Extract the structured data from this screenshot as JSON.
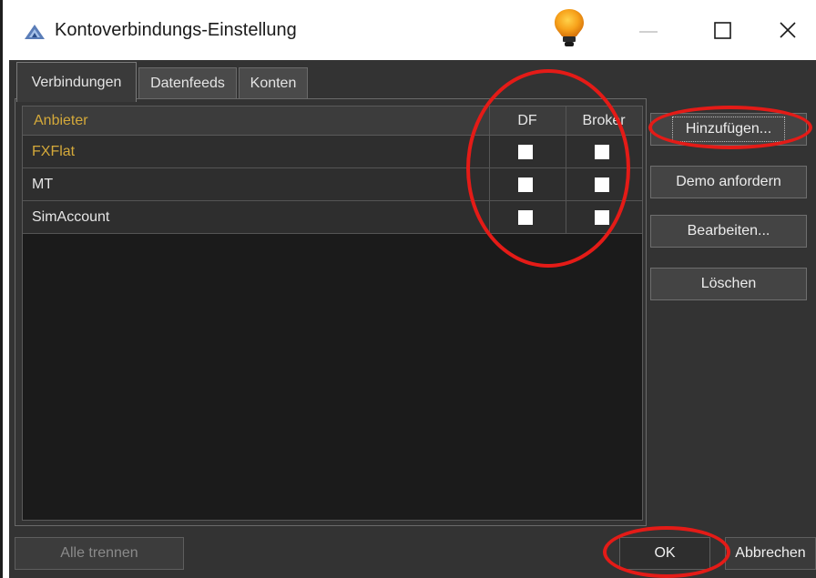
{
  "window": {
    "title": "Kontoverbindungs-Einstellung"
  },
  "tabs": [
    {
      "label": "Verbindungen",
      "active": true
    },
    {
      "label": "Datenfeeds",
      "active": false
    },
    {
      "label": "Konten",
      "active": false
    }
  ],
  "grid": {
    "columns": [
      "Anbieter",
      "DF",
      "Broker"
    ],
    "rows": [
      {
        "anbieter": "FXFlat",
        "df": false,
        "broker": false,
        "highlight": true
      },
      {
        "anbieter": "MT",
        "df": false,
        "broker": false,
        "highlight": false
      },
      {
        "anbieter": "SimAccount",
        "df": false,
        "broker": false,
        "highlight": false
      }
    ]
  },
  "side_buttons": {
    "add": "Hinzufügen...",
    "demo": "Demo anfordern",
    "edit": "Bearbeiten...",
    "delete": "Löschen"
  },
  "bottom_buttons": {
    "disconnect_all": "Alle trennen",
    "ok": "OK",
    "cancel": "Abbrechen"
  },
  "colors": {
    "accent_gold": "#d4a93a",
    "annotation_red": "#e41b17",
    "panel_bg": "#333333",
    "grid_bg": "#1b1b1b"
  },
  "icons": [
    "app-icon",
    "lightbulb-icon",
    "minimize-icon",
    "maximize-icon",
    "close-icon"
  ]
}
